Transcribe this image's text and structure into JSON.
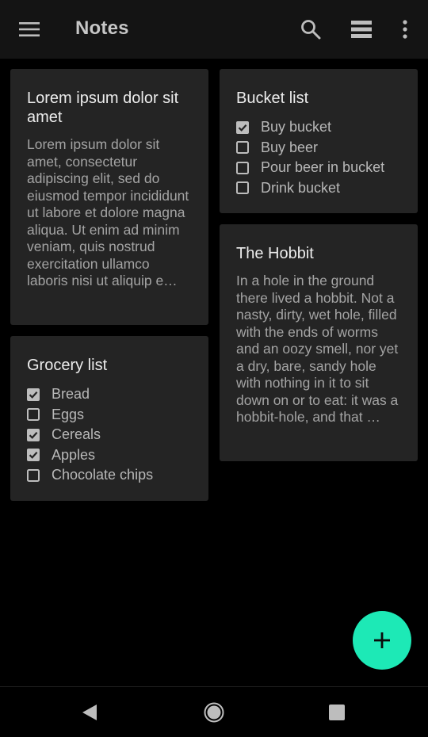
{
  "appbar": {
    "title": "Notes",
    "icons": [
      "menu-icon",
      "search-icon",
      "view-list-icon",
      "more-vert-icon"
    ]
  },
  "notes": [
    {
      "title": "Lorem ipsum dolor sit amet",
      "body": "Lorem ipsum dolor sit amet, consectetur adipiscing elit, sed do eiusmod tempor incididunt ut labore et dolore magna aliqua. Ut enim ad minim veniam, quis nostrud exercitation ullamco laboris nisi ut aliquip e…"
    },
    {
      "title": "Grocery list",
      "items": [
        {
          "label": "Bread",
          "checked": true
        },
        {
          "label": "Eggs",
          "checked": false
        },
        {
          "label": "Cereals",
          "checked": true
        },
        {
          "label": "Apples",
          "checked": true
        },
        {
          "label": "Chocolate chips",
          "checked": false
        }
      ]
    },
    {
      "title": "Bucket list",
      "items": [
        {
          "label": "Buy bucket",
          "checked": true
        },
        {
          "label": "Buy beer",
          "checked": false
        },
        {
          "label": "Pour beer in bucket",
          "checked": false
        },
        {
          "label": "Drink bucket",
          "checked": false
        }
      ]
    },
    {
      "title": "The Hobbit",
      "body": "In a hole in the ground there lived a hobbit. Not a nasty, dirty, wet hole, filled with the ends of worms and an oozy smell, nor yet a dry, bare, sandy hole with nothing in it to sit down on or to eat: it was a hobbit-hole, and that …"
    }
  ],
  "fab": {
    "icon": "add-icon"
  },
  "navbar": {
    "icons": [
      "back-icon",
      "home-icon",
      "recents-icon"
    ]
  },
  "colors": {
    "background": "#000000",
    "appbar": "#141414",
    "card": "#242424",
    "accent": "#1de9b6"
  }
}
